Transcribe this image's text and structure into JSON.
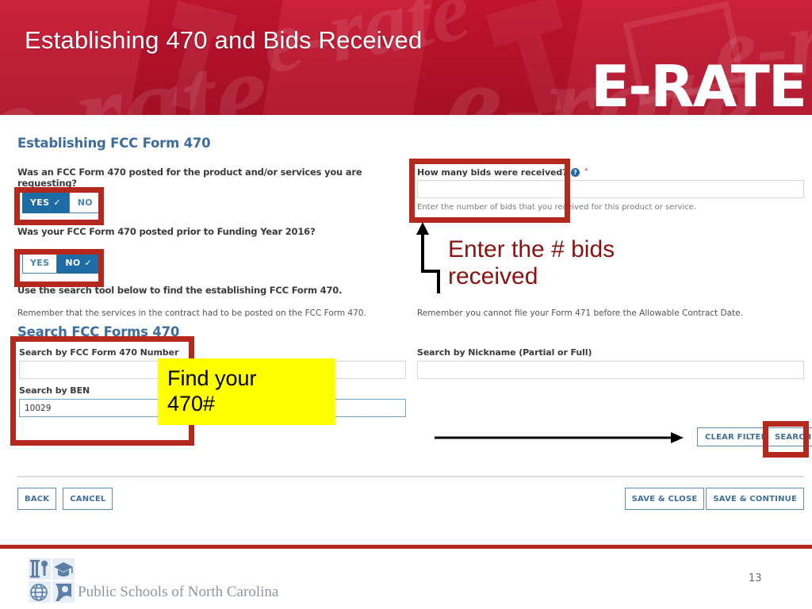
{
  "header": {
    "title": "Establishing 470 and Bids Received",
    "brand": "E-RATE",
    "watermark_text": "e-rate",
    "bg_color": "#c4122f"
  },
  "left_column": {
    "section_heading": "Establishing FCC Form 470",
    "question_1": "Was an FCC Form 470 posted for the product and/or services you are requesting?",
    "toggle_1": {
      "yes_label": "YES",
      "no_label": "NO",
      "selected": "YES",
      "check_glyph": "✓"
    },
    "question_2": "Was your FCC Form 470 posted prior to Funding Year 2016?",
    "toggle_2": {
      "yes_label": "YES",
      "no_label": "NO",
      "selected": "NO",
      "check_glyph": "✓"
    },
    "instruction": "Use the search tool below to find the establishing FCC Form 470.",
    "reminder": "Remember that the services in the contract had to be posted on the FCC Form 470.",
    "search_heading": "Search FCC Forms 470",
    "field_470_number": {
      "label": "Search by FCC Form 470 Number",
      "value": "",
      "placeholder": ""
    },
    "field_ben": {
      "label": "Search by BEN",
      "value": "10029",
      "placeholder": "",
      "focused": true
    }
  },
  "right_column": {
    "bids_question": "How many bids were received?",
    "bids_help_icon": "question-mark-icon",
    "bids_required_marker": "*",
    "bids_value": "",
    "bids_hint": "Enter the number of bids that you received for this product or service.",
    "reminder": "Remember you cannot file your Form 471 before the Allowable Contract Date.",
    "field_nickname": {
      "label": "Search by Nickname (Partial or Full)",
      "value": "",
      "placeholder": ""
    },
    "clear_filters_label": "CLEAR FILTERS",
    "search_label": "SEARCH"
  },
  "form_buttons": {
    "back": "BACK",
    "cancel": "CANCEL",
    "save_close": "SAVE & CLOSE",
    "save_continue": "SAVE & CONTINUE"
  },
  "annotations": {
    "yellow_note": {
      "line1": "Find your",
      "line2": "470#",
      "bg_color": "#ffff00"
    },
    "red_note": {
      "line1": "Enter the # bids",
      "line2": "received",
      "color": "#8c1210"
    },
    "highlight_color": "#b5281e"
  },
  "footer": {
    "organization": "Public Schools of North Carolina",
    "page_number": "13",
    "rule_color": "#b5281e",
    "logo_cells": [
      "column-building-icon",
      "graduation-cap-icon",
      "globe-icon",
      "scholar-icon"
    ]
  }
}
